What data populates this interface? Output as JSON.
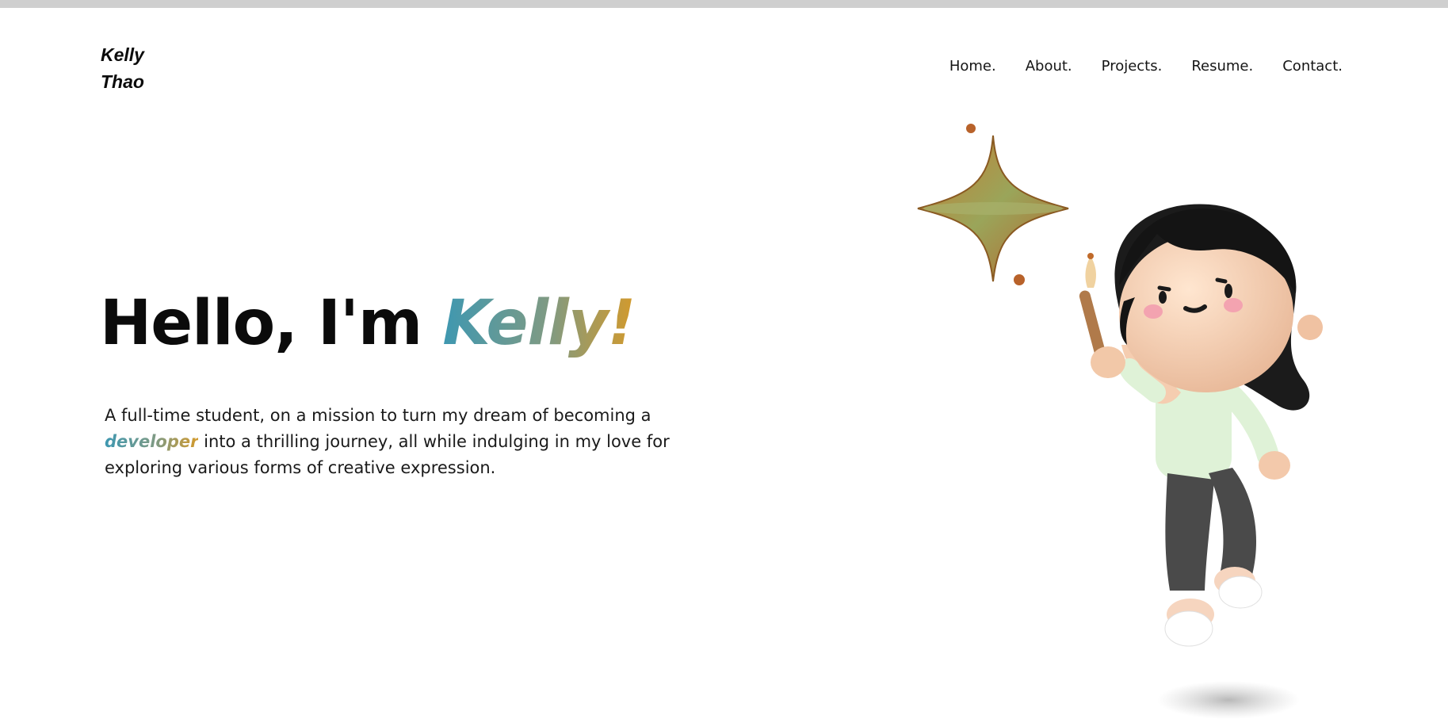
{
  "header": {
    "logo_line1": "Kelly",
    "logo_line2": "Thao",
    "nav": [
      {
        "label": "Home."
      },
      {
        "label": "About."
      },
      {
        "label": "Projects."
      },
      {
        "label": "Resume."
      },
      {
        "label": "Contact."
      }
    ]
  },
  "hero": {
    "greeting": "Hello, I'm ",
    "name": "Kelly!",
    "intro_before": "A full-time student, on a mission to turn my dream of becoming a ",
    "intro_highlight": "developer",
    "intro_after": " into a thrilling journey, all while indulging in my love for exploring various forms of creative expression.",
    "gradient_colors": [
      "#3e98b1",
      "#7f9a83",
      "#d39a2c"
    ]
  },
  "illustration": {
    "subject": "3d-avatar-holding-paintbrush",
    "accent": "sparkle-star"
  }
}
